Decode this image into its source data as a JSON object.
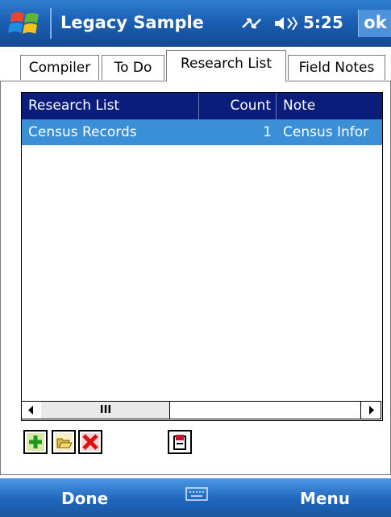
{
  "title_bar": {
    "title": "Legacy Sample",
    "clock": "5:25",
    "ok_label": "ok",
    "icons": [
      "windows-start-icon",
      "connectivity-icon",
      "volume-icon"
    ]
  },
  "tabs": [
    {
      "label": "Compiler",
      "active": false
    },
    {
      "label": "To Do",
      "active": false
    },
    {
      "label": "Research List",
      "active": true
    },
    {
      "label": "Field Notes",
      "active": false
    }
  ],
  "list": {
    "columns": [
      "Research List",
      "Count",
      "Note"
    ],
    "rows": [
      {
        "research_list": "Census Records",
        "count": "1",
        "note": "Census Infor"
      }
    ],
    "scroll_thumb_glyph": "III"
  },
  "toolbar": {
    "buttons": [
      "add-icon",
      "open-folder-icon",
      "delete-icon",
      "export-icon"
    ]
  },
  "bottom_bar": {
    "left_label": "Done",
    "right_label": "Menu",
    "keyboard_icon": "keyboard-icon"
  },
  "colors": {
    "titlebar": "#1b5fb3",
    "header": "#0a1d7a",
    "selection": "#3a8fd6",
    "bottombar": "#1f66bd"
  }
}
